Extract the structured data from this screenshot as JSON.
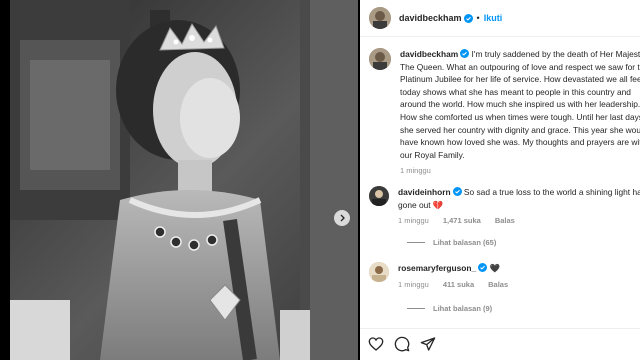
{
  "post": {
    "author": "davidbeckham",
    "follow_label": "Ikuti",
    "separator": "•"
  },
  "caption": {
    "username": "davidbeckham",
    "text": " I'm truly saddened by the death of Her Majesty, The Queen. What an outpouring of love and respect we saw for the Platinum Jubilee for her life of service. How devastated we all feel today shows what she has meant to people in this country and around the world. How much she inspired us with her leadership. How she comforted us when times were tough. Until her last days she served her country with dignity and grace. This year she would have known how loved she was. My thoughts and prayers are with our Royal Family.",
    "time": "1 minggu"
  },
  "comments": [
    {
      "username": "davideinhorn",
      "text": " So sad a true loss to the world a shining light has gone out 💔",
      "time": "1 minggu",
      "likes": "1,471 suka",
      "reply_label": "Balas",
      "view_replies": "Lihat balasan (65)"
    },
    {
      "username": "rosemaryferguson_",
      "text": " 🖤",
      "time": "1 minggu",
      "likes": "411 suka",
      "reply_label": "Balas",
      "view_replies": "Lihat balasan (9)"
    }
  ],
  "icons": {
    "verified": "verified-badge-icon",
    "next": "chevron-right-icon",
    "like": "heart-icon",
    "comment": "comment-icon",
    "share": "send-icon"
  },
  "colors": {
    "verified": "#0095f6",
    "follow": "#0095f6",
    "muted": "#8e8e8e",
    "text": "#262626"
  }
}
